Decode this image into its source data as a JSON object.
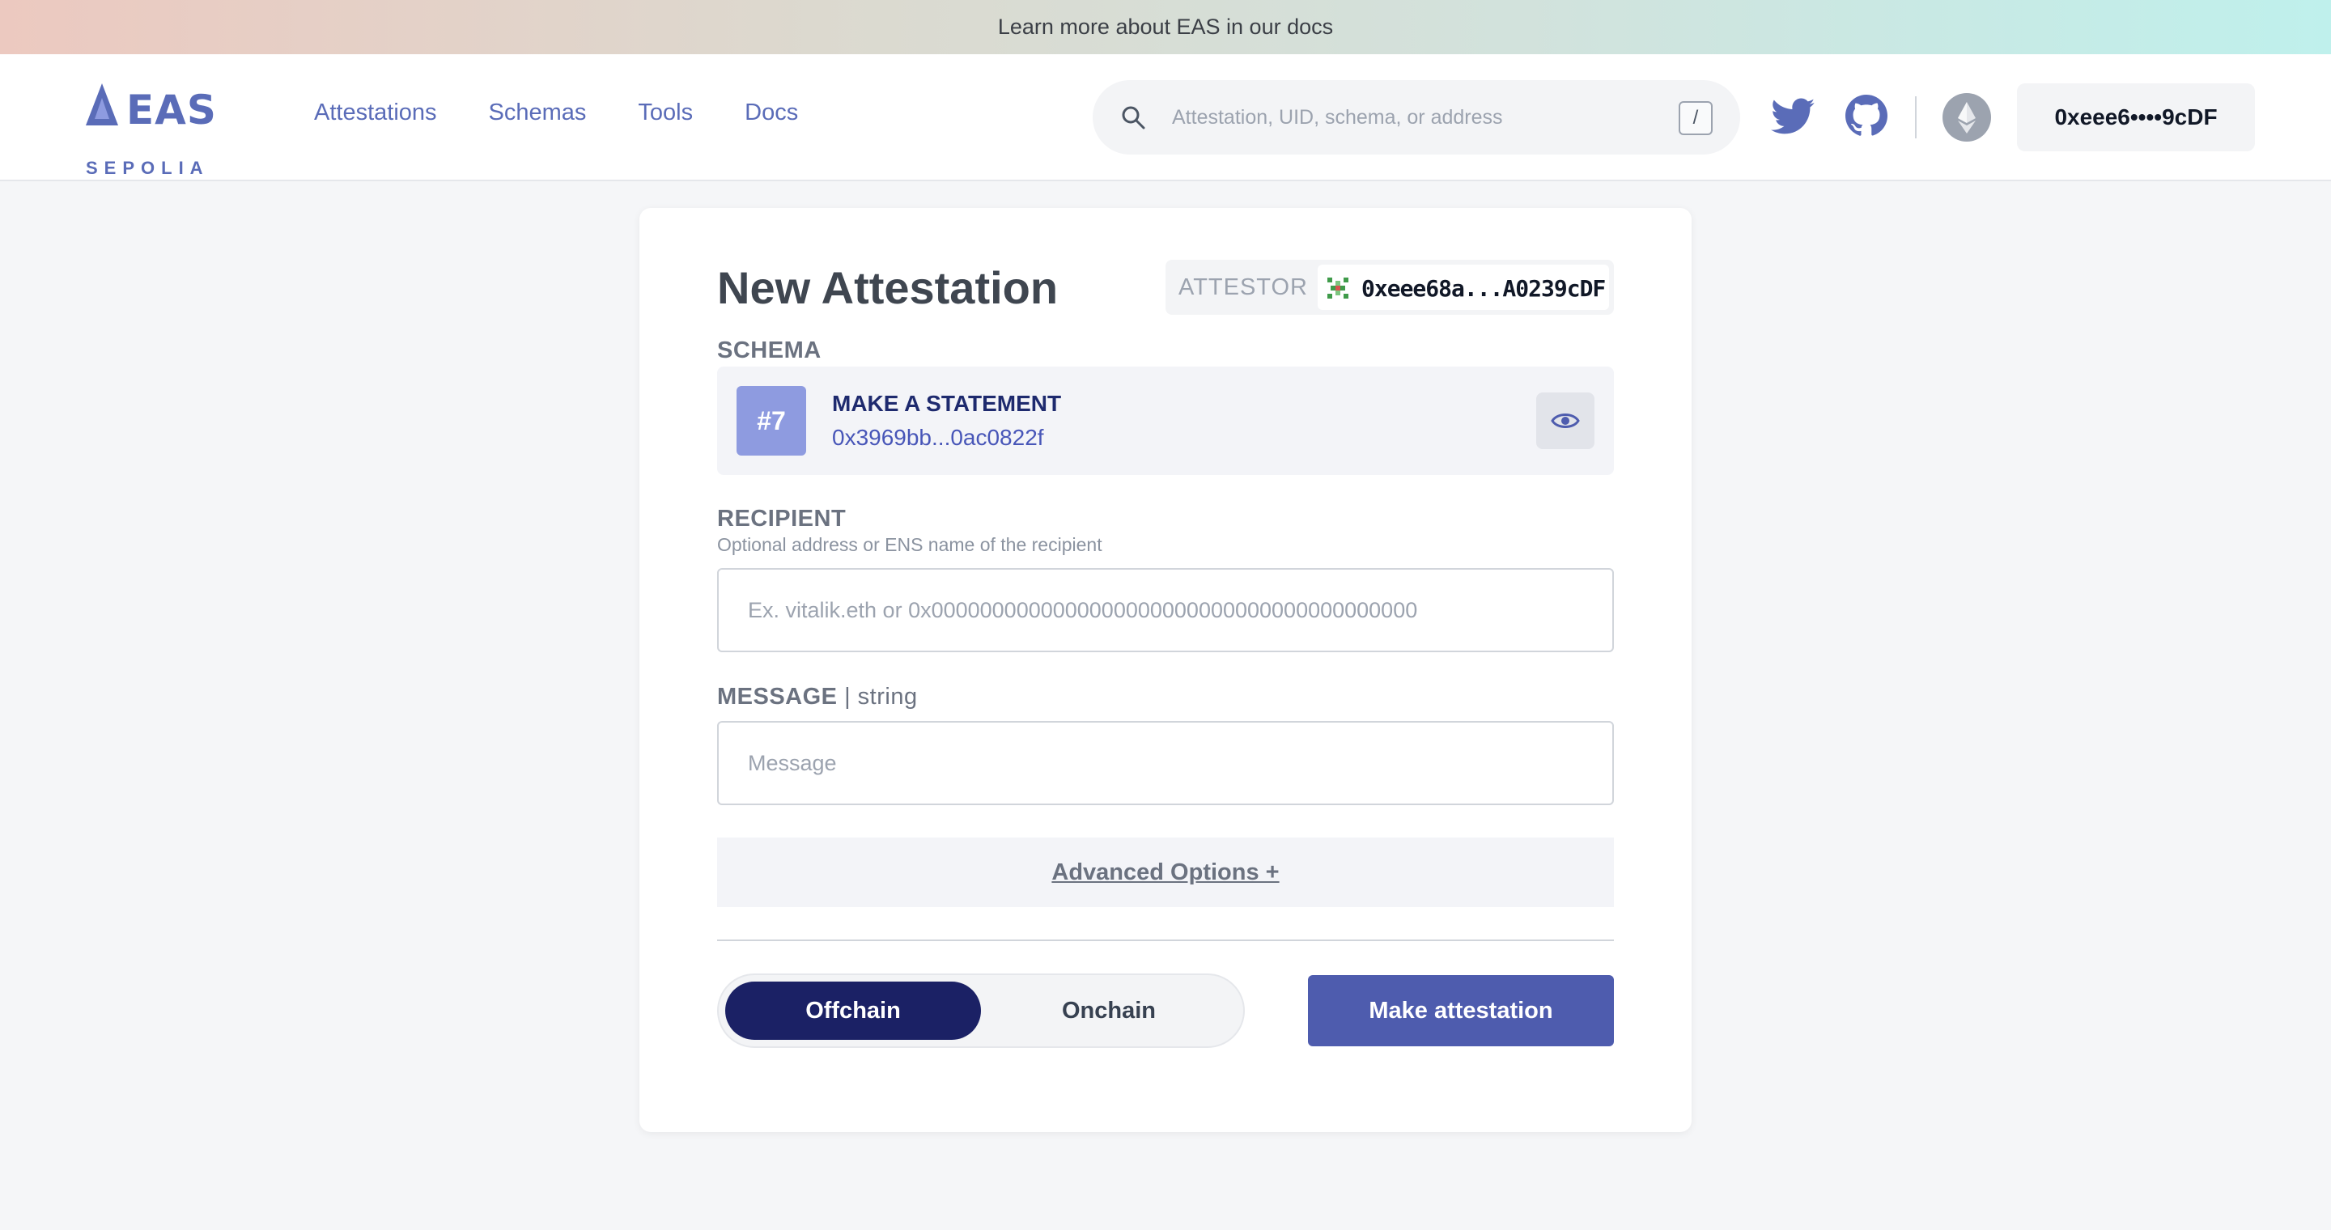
{
  "banner": {
    "text": "Learn more about EAS in our docs"
  },
  "brand": {
    "name": "EAS",
    "network": "SEPOLIA",
    "color": "#5a6cb8"
  },
  "nav": [
    {
      "label": "Attestations"
    },
    {
      "label": "Schemas"
    },
    {
      "label": "Tools"
    },
    {
      "label": "Docs"
    }
  ],
  "search": {
    "placeholder": "Attestation, UID, schema, or address",
    "shortcut": "/"
  },
  "header_icons": [
    "twitter-icon",
    "github-icon",
    "ethereum-icon"
  ],
  "wallet": {
    "label": "0xeee6••••9cDF"
  },
  "form": {
    "title": "New Attestation",
    "attestor": {
      "label": "ATTESTOR",
      "address": "0xeee68a...A0239cDF"
    },
    "schema": {
      "label": "SCHEMA",
      "number": "#7",
      "name": "MAKE A STATEMENT",
      "uid": "0x3969bb...0ac0822f"
    },
    "recipient": {
      "label": "RECIPIENT",
      "helper": "Optional address or ENS name of the recipient",
      "placeholder": "Ex. vitalik.eth or 0x0000000000000000000000000000000000000000",
      "value": ""
    },
    "message": {
      "label": "MESSAGE",
      "type": " | string",
      "placeholder": "Message",
      "value": ""
    },
    "advanced_label": "Advanced Options +",
    "toggle": {
      "options": [
        "Offchain",
        "Onchain"
      ],
      "selected": "Offchain"
    },
    "submit_label": "Make attestation"
  },
  "colors": {
    "accent": "#5a6cb8",
    "toggle_active": "#1b2165",
    "submit": "#4e5cae",
    "schema_badge": "#8e9be0"
  }
}
